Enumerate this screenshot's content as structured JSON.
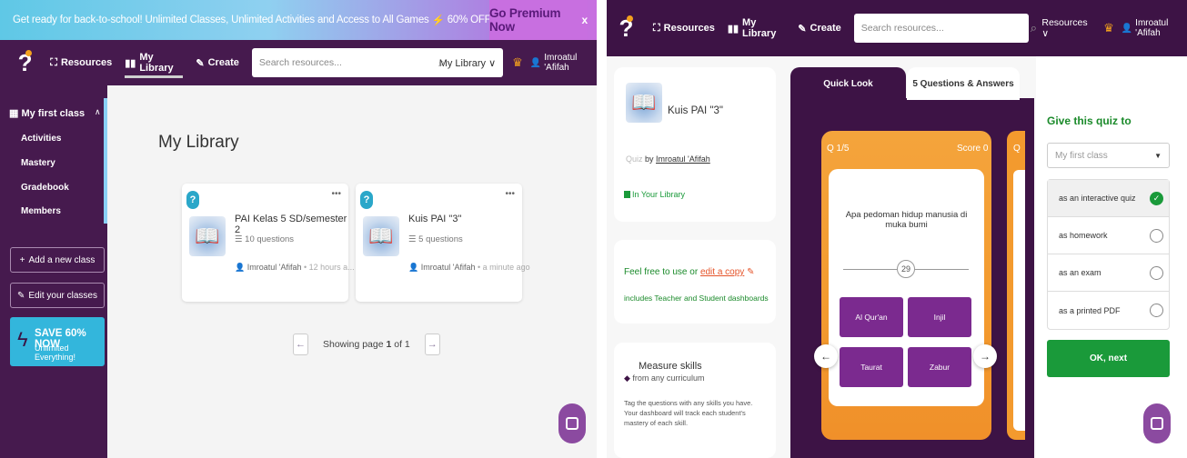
{
  "promo": {
    "text": "Get ready for back-to-school!  Unlimited Classes, Unlimited Activities and Access to All Games",
    "bolt": "⚡",
    "offer": "60% OFF (Ends 31st July)",
    "cta": "Go Premium Now",
    "close": "x"
  },
  "nav": {
    "resources": "Resources",
    "library": "My Library",
    "create": "Create",
    "search_placeholder": "Search resources...",
    "left_select": "My Library ∨",
    "right_select": "Resources ∨",
    "user": "Imroatul 'Afifah"
  },
  "sidebar": {
    "class_name": "My first class",
    "caret": "∧",
    "items": [
      "Activities",
      "Mastery",
      "Gradebook",
      "Members"
    ],
    "add_class": "Add a new class",
    "edit_classes": "Edit your classes",
    "save_title": "SAVE 60% NOW",
    "save_sub": "Unlimited Everything!"
  },
  "library": {
    "title": "My Library",
    "cards": [
      {
        "title": "PAI Kelas 5 SD/semester 2",
        "questions": "10 questions",
        "author": "Imroatul 'Afifah",
        "time": "• 12 hours a..."
      },
      {
        "title": "Kuis PAI \"3\"",
        "questions": "5 questions",
        "author": "Imroatul 'Afifah",
        "time": "• a minute ago"
      }
    ],
    "pager_prefix": "Showing page ",
    "pager_page": "1",
    "pager_suffix": " of 1"
  },
  "detail": {
    "quiz_title": "Kuis PAI \"3\"",
    "quiz_label": "Quiz",
    "by_label": " by ",
    "author": "Imroatul 'Afifah",
    "in_library": "In Your Library",
    "free_prefix": "Feel free to use or ",
    "free_link": "edit a copy",
    "includes": "includes Teacher and Student dashboards",
    "measure_title": "Measure skills",
    "measure_sub": "from any curriculum",
    "measure_text": "Tag the questions with any skills you have. Your dashboard will track each student's mastery of each skill.",
    "tab_quicklook": "Quick Look",
    "tab_questions": "5 Questions & Answers",
    "q_label": "Q 1/5",
    "score_label": "Score 0",
    "q_next_label": "Q",
    "question": "Apa pedoman hidup manusia di muka bumi",
    "slider_value": "29",
    "options": [
      "Al Qur'an",
      "Injil",
      "Taurat",
      "Zabur"
    ]
  },
  "assign": {
    "title": "Give this quiz to",
    "class_select": "My first class",
    "options": [
      "as an interactive quiz",
      "as homework",
      "as an exam",
      "as a printed PDF"
    ],
    "selected_index": 0,
    "ok": "OK, next"
  },
  "colors": {
    "purple_dark": "#461a4e",
    "accent_blue": "#33b6dc",
    "green": "#1a9a3a",
    "orange": "#f39a2e",
    "option_purple": "#7b2a8f"
  }
}
